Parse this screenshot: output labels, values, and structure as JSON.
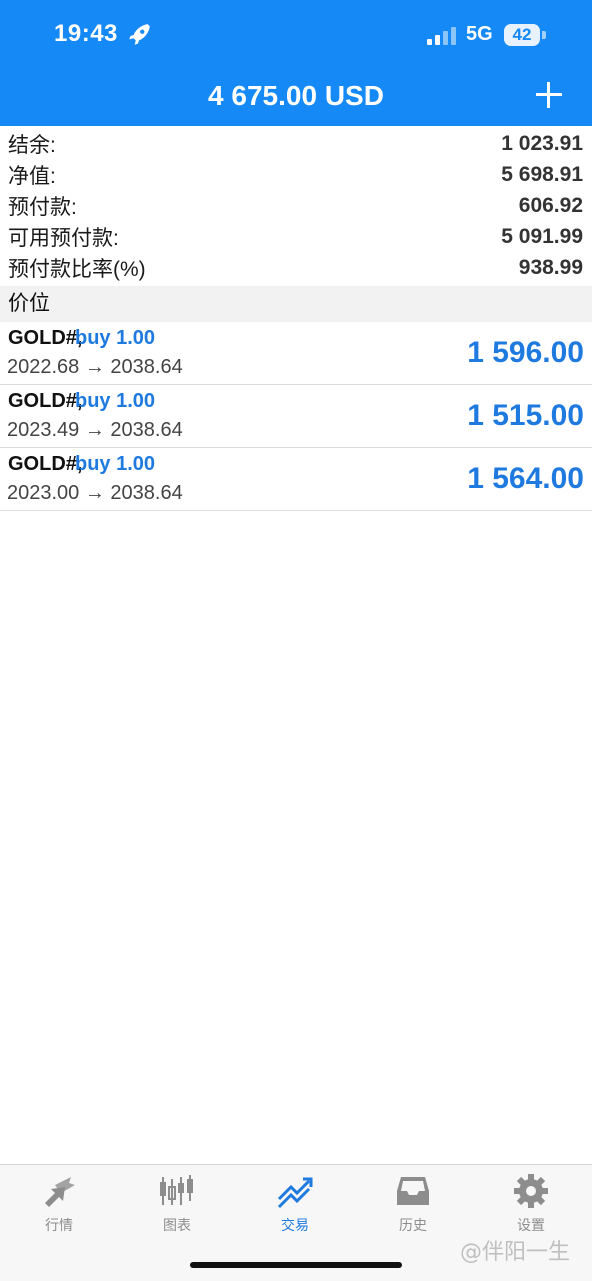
{
  "status_bar": {
    "time": "19:43",
    "network": "5G",
    "battery": "42"
  },
  "header": {
    "title": "4 675.00 USD"
  },
  "summary": [
    {
      "label": "结余:",
      "value": "1 023.91"
    },
    {
      "label": "净值:",
      "value": "5 698.91"
    },
    {
      "label": "预付款:",
      "value": "606.92"
    },
    {
      "label": "可用预付款:",
      "value": "5 091.99"
    },
    {
      "label": "预付款比率(%)",
      "value": "938.99"
    }
  ],
  "positions_header": "价位",
  "positions": [
    {
      "symbol": "GOLD#,",
      "side": "buy 1.00",
      "prices": "2022.68 → 2038.64",
      "profit": "1 596.00"
    },
    {
      "symbol": "GOLD#,",
      "side": "buy 1.00",
      "prices": "2023.49 → 2038.64",
      "profit": "1 515.00"
    },
    {
      "symbol": "GOLD#,",
      "side": "buy 1.00",
      "prices": "2023.00 → 2038.64",
      "profit": "1 564.00"
    }
  ],
  "tabs": [
    {
      "label": "行情",
      "icon": "quotes-icon"
    },
    {
      "label": "图表",
      "icon": "chart-icon"
    },
    {
      "label": "交易",
      "icon": "trade-icon",
      "active": true
    },
    {
      "label": "历史",
      "icon": "history-icon"
    },
    {
      "label": "设置",
      "icon": "settings-icon"
    }
  ],
  "watermark": "@伴阳一生",
  "colors": {
    "header_bg": "#1589f6",
    "accent_blue": "#1f7ae0",
    "tab_inactive": "#8d8d8d"
  }
}
